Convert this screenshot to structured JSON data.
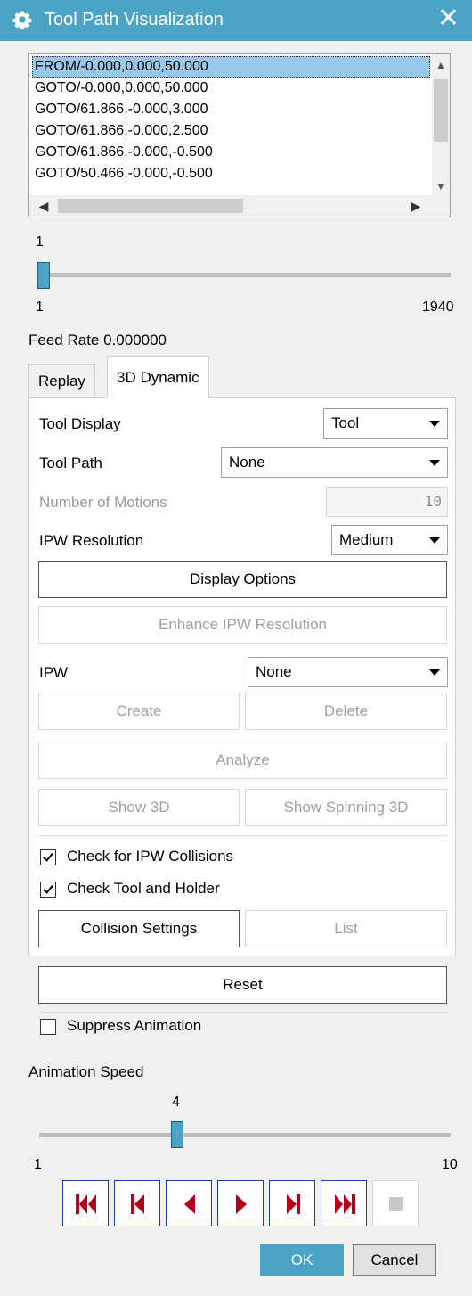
{
  "window": {
    "title": "Tool Path Visualization",
    "close_glyph": "✕",
    "icon": "gear-icon"
  },
  "path_list": {
    "rows": [
      "FROM/-0.000,0.000,50.000",
      "GOTO/-0.000,0.000,50.000",
      "GOTO/61.866,-0.000,3.000",
      "GOTO/61.866,-0.000,2.500",
      "GOTO/61.866,-0.000,-0.500",
      "GOTO/50.466,-0.000,-0.500"
    ],
    "selected_index": 0
  },
  "motion_slider": {
    "value": "1",
    "min": "1",
    "max": "1940"
  },
  "feed_rate": "Feed Rate 0.000000",
  "tabs": [
    {
      "label": "Replay"
    },
    {
      "label": "3D Dynamic"
    }
  ],
  "active_tab": "3D Dynamic",
  "dynamic": {
    "tool_display_label": "Tool Display",
    "tool_display_value": "Tool",
    "tool_path_label": "Tool Path",
    "tool_path_value": "None",
    "num_motions_label": "Number of Motions",
    "num_motions_value": "10",
    "ipw_res_label": "IPW Resolution",
    "ipw_res_value": "Medium",
    "display_options": "Display Options",
    "enhance_ipw": "Enhance IPW Resolution",
    "ipw_label": "IPW",
    "ipw_value": "None",
    "create": "Create",
    "delete": "Delete",
    "analyze": "Analyze",
    "show_3d": "Show 3D",
    "show_spinning_3d": "Show Spinning 3D",
    "check_ipw_collisions": "Check for IPW Collisions",
    "check_ipw_collisions_checked": true,
    "check_tool_holder": "Check Tool and Holder",
    "check_tool_holder_checked": true,
    "collision_settings": "Collision Settings",
    "list": "List",
    "reset": "Reset",
    "suppress_animation": "Suppress Animation",
    "suppress_animation_checked": false
  },
  "animation_speed": {
    "label": "Animation Speed",
    "value": "4",
    "min": "1",
    "max": "10"
  },
  "playback": {
    "icons": [
      "skip-to-start-icon",
      "step-back-icon",
      "play-reverse-icon",
      "play-forward-icon",
      "step-forward-icon",
      "skip-to-end-icon",
      "stop-icon"
    ],
    "color": "#b3001b"
  },
  "footer": {
    "ok": "OK",
    "cancel": "Cancel"
  },
  "colors": {
    "accent": "#4ba4c5",
    "selection": "#99c9ea",
    "playback": "#b3001b",
    "playback_border": "#1b3fa0"
  }
}
